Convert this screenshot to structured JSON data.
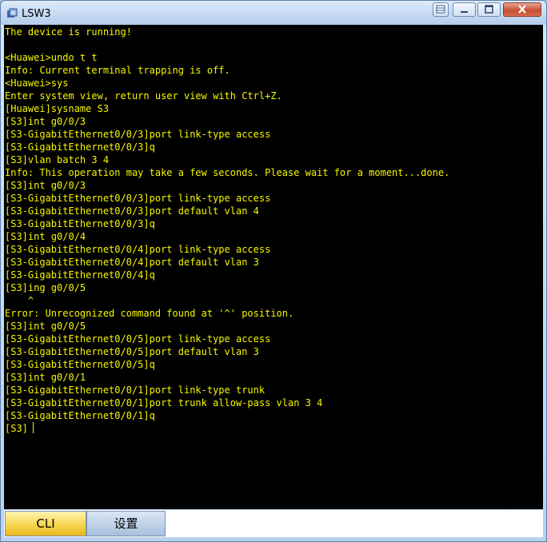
{
  "window": {
    "title": "LSW3",
    "controls": {
      "minimize": "minimize",
      "maximize": "maximize",
      "close": "close"
    }
  },
  "terminal": {
    "lines": [
      "The device is running!",
      "",
      "<Huawei>undo t t",
      "Info: Current terminal trapping is off.",
      "<Huawei>sys",
      "Enter system view, return user view with Ctrl+Z.",
      "[Huawei]sysname S3",
      "[S3]int g0/0/3",
      "[S3-GigabitEthernet0/0/3]port link-type access",
      "[S3-GigabitEthernet0/0/3]q",
      "[S3]vlan batch 3 4",
      "Info: This operation may take a few seconds. Please wait for a moment...done.",
      "[S3]int g0/0/3",
      "[S3-GigabitEthernet0/0/3]port link-type access",
      "[S3-GigabitEthernet0/0/3]port default vlan 4",
      "[S3-GigabitEthernet0/0/3]q",
      "[S3]int g0/0/4",
      "[S3-GigabitEthernet0/0/4]port link-type access",
      "[S3-GigabitEthernet0/0/4]port default vlan 3",
      "[S3-GigabitEthernet0/0/4]q",
      "[S3]ing g0/0/5",
      "    ^",
      "Error: Unrecognized command found at '^' position.",
      "[S3]int g0/0/5",
      "[S3-GigabitEthernet0/0/5]port link-type access",
      "[S3-GigabitEthernet0/0/5]port default vlan 3",
      "[S3-GigabitEthernet0/0/5]q",
      "[S3]int g0/0/1",
      "[S3-GigabitEthernet0/0/1]port link-type trunk",
      "[S3-GigabitEthernet0/0/1]port trunk allow-pass vlan 3 4",
      "[S3-GigabitEthernet0/0/1]q",
      "[S3]"
    ],
    "text_color": "#f6f600",
    "background": "#000000"
  },
  "tabs": [
    {
      "label": "CLI",
      "active": true
    },
    {
      "label": "设置",
      "active": false
    }
  ]
}
